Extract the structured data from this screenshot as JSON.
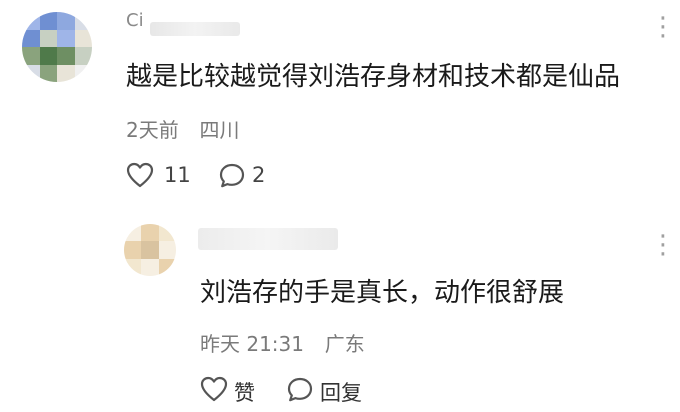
{
  "comments": [
    {
      "username_partial": "Ci",
      "text": "越是比较越觉得刘浩存身材和技术都是仙品",
      "time": "2天前",
      "location": "四川",
      "like_count": "11",
      "reply_count": "2",
      "icons": {
        "like": "heart-icon",
        "reply": "comment-bubble-icon",
        "more": "more-dots-icon"
      }
    }
  ],
  "reply": {
    "text": "刘浩存的手是真长，动作很舒展",
    "time": "昨天 21:31",
    "location": "广东",
    "like_label": "赞",
    "reply_label": "回复",
    "icons": {
      "like": "heart-icon",
      "reply": "comment-bubble-icon",
      "more": "more-dots-icon"
    }
  },
  "more_glyph": "⋮",
  "colors": {
    "text": "#1a1a1a",
    "muted": "#7a7a7a",
    "avatar_pixels": [
      "#6f8fd2",
      "#9fb5e8",
      "#d8dde6",
      "#4f7a4a",
      "#8aa37d",
      "#c7d0c2",
      "#e8e4d8"
    ],
    "reply_avatar_pixels": [
      "#f2e7cf",
      "#e9d2ad",
      "#f6efe2",
      "#d9c3a0"
    ]
  }
}
